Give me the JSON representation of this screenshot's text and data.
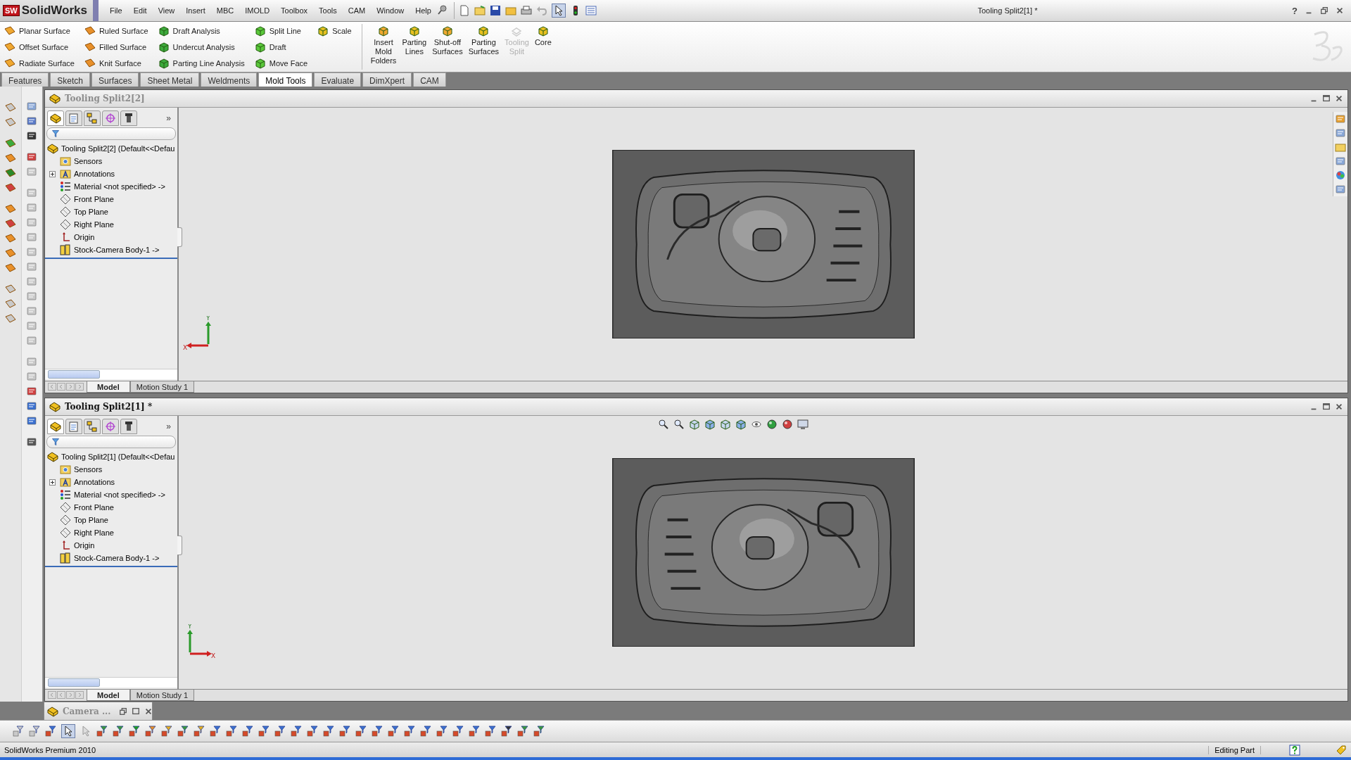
{
  "app": {
    "logo_badge": "SW",
    "logo": "SolidWorks",
    "document_title": "Tooling Split2[1] *",
    "help_glyph": "?"
  },
  "menu": [
    "File",
    "Edit",
    "View",
    "Insert",
    "MBC",
    "IMOLD",
    "Toolbox",
    "Tools",
    "CAM",
    "Window",
    "Help"
  ],
  "ribbon": {
    "columns": [
      [
        {
          "label": "Planar Surface"
        },
        {
          "label": "Offset Surface"
        },
        {
          "label": "Radiate Surface"
        }
      ],
      [
        {
          "label": "Ruled Surface"
        },
        {
          "label": "Filled Surface"
        },
        {
          "label": "Knit Surface"
        }
      ],
      [
        {
          "label": "Draft Analysis"
        },
        {
          "label": "Undercut Analysis"
        },
        {
          "label": "Parting Line Analysis"
        }
      ],
      [
        {
          "label": "Split Line"
        },
        {
          "label": "Draft"
        },
        {
          "label": "Move Face"
        }
      ],
      [
        {
          "label": "Scale"
        }
      ]
    ],
    "large_buttons": [
      {
        "label": "Insert Mold Folders",
        "disabled": false
      },
      {
        "label": "Parting Lines",
        "disabled": false
      },
      {
        "label": "Shut-off Surfaces",
        "disabled": false
      },
      {
        "label": "Parting Surfaces",
        "disabled": false
      },
      {
        "label": "Tooling Split",
        "disabled": true
      },
      {
        "label": "Core",
        "disabled": false
      }
    ]
  },
  "command_tabs": [
    {
      "label": "Features",
      "selected": false
    },
    {
      "label": "Sketch",
      "selected": false
    },
    {
      "label": "Surfaces",
      "selected": false
    },
    {
      "label": "Sheet Metal",
      "selected": false
    },
    {
      "label": "Weldments",
      "selected": false
    },
    {
      "label": "Mold Tools",
      "selected": true
    },
    {
      "label": "Evaluate",
      "selected": false
    },
    {
      "label": "DimXpert",
      "selected": false
    },
    {
      "label": "CAM",
      "selected": false
    }
  ],
  "documents": [
    {
      "title": "Tooling Split2[2]",
      "active": false,
      "task_pane": true,
      "mirrored": false,
      "x_points_left": true,
      "more_glyph": "»",
      "panel_tabs": [
        {
          "selected": true
        },
        {
          "selected": false
        },
        {
          "selected": false
        },
        {
          "selected": false
        },
        {
          "selected": false
        }
      ],
      "tree": {
        "root": "Tooling Split2[2]  (Default<<Defau",
        "items": [
          {
            "label": "Sensors",
            "kind": "sensors"
          },
          {
            "label": "Annotations",
            "kind": "annotations",
            "expanded": false
          },
          {
            "label": "Material <not specified> ->",
            "kind": "material"
          },
          {
            "label": "Front Plane",
            "kind": "plane"
          },
          {
            "label": "Top Plane",
            "kind": "plane"
          },
          {
            "label": "Right Plane",
            "kind": "plane"
          },
          {
            "label": "Origin",
            "kind": "origin"
          },
          {
            "label": "Stock-Camera Body-1 ->",
            "kind": "stock"
          }
        ]
      },
      "triad": {
        "x": "X",
        "y": "Y"
      },
      "bottom_tabs": [
        {
          "label": "Model",
          "selected": true
        },
        {
          "label": "Motion Study 1",
          "selected": false
        }
      ]
    },
    {
      "title": "Tooling Split2[1] *",
      "active": true,
      "task_pane": false,
      "mirrored": true,
      "x_points_left": false,
      "more_glyph": "»",
      "panel_tabs": [
        {
          "selected": true
        },
        {
          "selected": false
        },
        {
          "selected": false
        },
        {
          "selected": false
        },
        {
          "selected": false
        }
      ],
      "tree": {
        "root": "Tooling Split2[1]  (Default<<Defau",
        "items": [
          {
            "label": "Sensors",
            "kind": "sensors"
          },
          {
            "label": "Annotations",
            "kind": "annotations",
            "expanded": false
          },
          {
            "label": "Material <not specified> ->",
            "kind": "material"
          },
          {
            "label": "Front Plane",
            "kind": "plane"
          },
          {
            "label": "Top Plane",
            "kind": "plane"
          },
          {
            "label": "Right Plane",
            "kind": "plane"
          },
          {
            "label": "Origin",
            "kind": "origin"
          },
          {
            "label": "Stock-Camera Body-1 ->",
            "kind": "stock"
          }
        ]
      },
      "triad": {
        "x": "X",
        "y": "Y"
      },
      "bottom_tabs": [
        {
          "label": "Model",
          "selected": true
        },
        {
          "label": "Motion Study 1",
          "selected": false
        }
      ]
    }
  ],
  "minimized_window": {
    "title": "Camera ..."
  },
  "status_bar": {
    "product": "SolidWorks Premium 2010",
    "mode": "Editing Part"
  }
}
